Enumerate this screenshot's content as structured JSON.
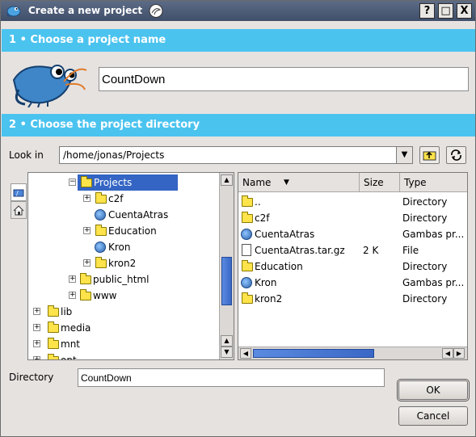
{
  "window": {
    "title": "Create a new project",
    "buttons": {
      "help": "?",
      "maximize": "□",
      "close": "X"
    }
  },
  "section1": {
    "title": "1 • Choose a project name"
  },
  "project_name": {
    "value": "CountDown"
  },
  "section2": {
    "title": "2 • Choose the project directory"
  },
  "look_in": {
    "label": "Look in",
    "value": "/home/jonas/Projects"
  },
  "tree": {
    "items": [
      {
        "label": "Projects",
        "icon": "folder-icon"
      },
      {
        "label": "c2f",
        "icon": "folder-icon"
      },
      {
        "label": "CuentaAtras",
        "icon": "gambas-project-icon"
      },
      {
        "label": "Education",
        "icon": "folder-icon"
      },
      {
        "label": "Kron",
        "icon": "gambas-project-icon"
      },
      {
        "label": "kron2",
        "icon": "folder-icon"
      },
      {
        "label": "public_html",
        "icon": "folder-icon"
      },
      {
        "label": "www",
        "icon": "folder-icon"
      },
      {
        "label": "lib",
        "icon": "folder-icon"
      },
      {
        "label": "media",
        "icon": "folder-icon"
      },
      {
        "label": "mnt",
        "icon": "folder-icon"
      },
      {
        "label": "opt",
        "icon": "folder-icon"
      }
    ]
  },
  "list": {
    "columns": {
      "name": "Name",
      "size": "Size",
      "type": "Type"
    },
    "rows": [
      {
        "name": "..",
        "size": "",
        "type": "Directory",
        "icon": "folder-icon"
      },
      {
        "name": "c2f",
        "size": "",
        "type": "Directory",
        "icon": "folder-icon"
      },
      {
        "name": "CuentaAtras",
        "size": "",
        "type": "Gambas pr...",
        "icon": "gambas-project-icon"
      },
      {
        "name": "CuentaAtras.tar.gz",
        "size": "2 K",
        "type": "File",
        "icon": "file-icon"
      },
      {
        "name": "Education",
        "size": "",
        "type": "Directory",
        "icon": "folder-icon"
      },
      {
        "name": "Kron",
        "size": "",
        "type": "Gambas pr...",
        "icon": "gambas-project-icon"
      },
      {
        "name": "kron2",
        "size": "",
        "type": "Directory",
        "icon": "folder-icon"
      }
    ]
  },
  "directory": {
    "label": "Directory",
    "value": "CountDown"
  },
  "buttons": {
    "ok": "OK",
    "cancel": "Cancel"
  }
}
